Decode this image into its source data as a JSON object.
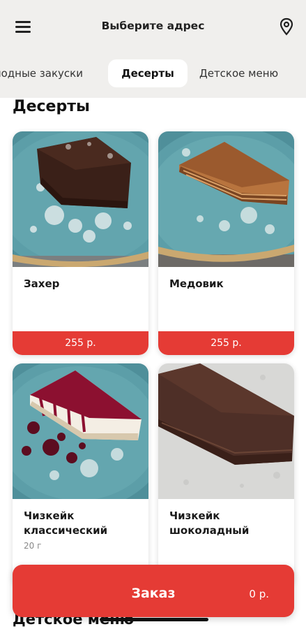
{
  "header": {
    "title": "Выберите адрес",
    "menu_icon": "hamburger-menu-icon",
    "location_icon": "map-pin-icon"
  },
  "tabs": [
    {
      "label": "лодные закуски"
    },
    {
      "label": "Десерты",
      "active": true
    },
    {
      "label": "Детское меню"
    }
  ],
  "section": {
    "title": "Десерты"
  },
  "products": [
    {
      "name": "Захер",
      "weight": "",
      "price": "255 р."
    },
    {
      "name": "Медовик",
      "weight": "",
      "price": "255 р."
    },
    {
      "name": "Чизкейк классический",
      "weight": "20 г",
      "price": ""
    },
    {
      "name": "Чизкейк шоколадный",
      "weight": "",
      "price": ""
    }
  ],
  "next_section": {
    "title": "Детское меню"
  },
  "order": {
    "label": "Заказ",
    "total": "0 р."
  },
  "colors": {
    "accent": "#e53b35",
    "header_bg": "#f0efed",
    "plate": "#5a9aa5"
  }
}
